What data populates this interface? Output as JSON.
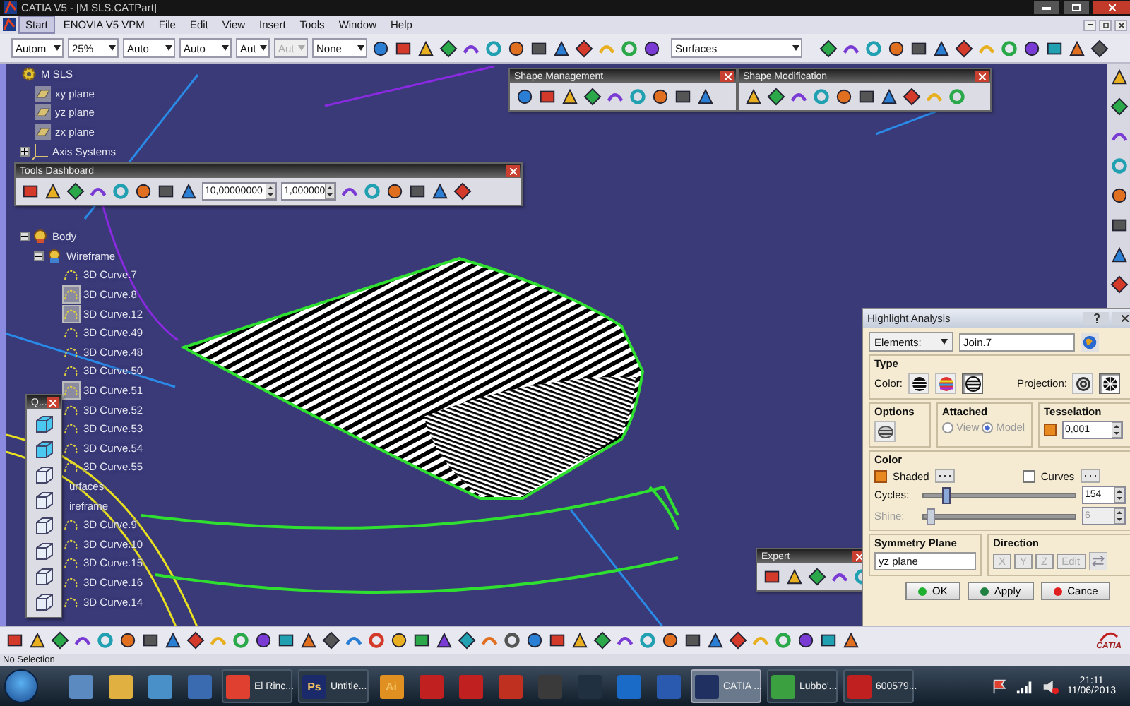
{
  "window": {
    "title": "CATIA V5 - [M SLS.CATPart]"
  },
  "menu": [
    {
      "label": "Start",
      "selected": true
    },
    {
      "label": "ENOVIA V5 VPM",
      "selected": false
    },
    {
      "label": "File",
      "selected": false
    },
    {
      "label": "Edit",
      "selected": false
    },
    {
      "label": "View",
      "selected": false
    },
    {
      "label": "Insert",
      "selected": false
    },
    {
      "label": "Tools",
      "selected": false
    },
    {
      "label": "Window",
      "selected": false
    },
    {
      "label": "Help",
      "selected": false
    }
  ],
  "toolbar": {
    "combos": [
      {
        "value": "Autom",
        "disabled": false
      },
      {
        "value": "25%",
        "disabled": false
      },
      {
        "value": "Auto",
        "disabled": false
      },
      {
        "value": "Auto",
        "disabled": false
      },
      {
        "value": "Aut",
        "disabled": false
      },
      {
        "value": "Aut",
        "disabled": true
      },
      {
        "value": "None",
        "disabled": false
      }
    ],
    "workbench": "Surfaces"
  },
  "tree": {
    "label": "M SLS",
    "kind": "part",
    "children": [
      {
        "label": "xy plane",
        "kind": "plane"
      },
      {
        "label": "yz plane",
        "kind": "plane"
      },
      {
        "label": "zx plane",
        "kind": "plane"
      },
      {
        "label": "Axis Systems",
        "kind": "axis",
        "expanded": false
      },
      {
        "label": "Body",
        "kind": "body",
        "expanded": true,
        "children": [
          {
            "label": "Wireframe",
            "kind": "set",
            "expanded": true,
            "children": [
              {
                "label": "3D Curve.7",
                "kind": "curve",
                "hidden": false
              },
              {
                "label": "3D Curve.8",
                "kind": "curve",
                "hidden": true
              },
              {
                "label": "3D Curve.12",
                "kind": "curve",
                "hidden": true
              },
              {
                "label": "3D Curve.49",
                "kind": "curve",
                "hidden": false
              },
              {
                "label": "3D Curve.48",
                "kind": "curve",
                "hidden": false
              },
              {
                "label": "3D Curve.50",
                "kind": "curve",
                "hidden": false
              },
              {
                "label": "3D Curve.51",
                "kind": "curve",
                "hidden": true
              },
              {
                "label": "3D Curve.52",
                "kind": "curve",
                "hidden": false
              },
              {
                "label": "3D Curve.53",
                "kind": "curve",
                "hidden": false
              },
              {
                "label": "3D Curve.54",
                "kind": "curve",
                "hidden": false
              },
              {
                "label": "3D Curve.55",
                "kind": "curve",
                "hidden": false
              }
            ]
          },
          {
            "label": "urfaces",
            "kind": "cut"
          },
          {
            "label": "ireframe",
            "kind": "cut",
            "children": [
              {
                "label": "3D Curve.9",
                "kind": "curve",
                "hidden": false
              },
              {
                "label": "3D Curve.10",
                "kind": "curve",
                "hidden": false
              },
              {
                "label": "3D Curve.15",
                "kind": "curve",
                "hidden": false
              },
              {
                "label": "3D Curve.16",
                "kind": "curve",
                "hidden": false
              },
              {
                "label": "3D Curve.14",
                "kind": "curve",
                "hidden": false
              }
            ]
          }
        ]
      }
    ]
  },
  "tools_dashboard": {
    "title": "Tools Dashboard",
    "fields": [
      "10,00000000",
      "1,000000"
    ]
  },
  "shape_management": {
    "title": "Shape Management"
  },
  "shape_modification": {
    "title": "Shape Modification"
  },
  "quick_view": {
    "title": "Q..."
  },
  "expert": {
    "title": "Expert"
  },
  "highlight_analysis": {
    "title": "Highlight Analysis",
    "elements": {
      "label": "Elements:",
      "value": "Join.7"
    },
    "type": {
      "title": "Type",
      "color_label": "Color:",
      "color_modes": [
        {
          "selected": false
        },
        {
          "selected": false
        },
        {
          "selected": true
        }
      ],
      "projection_label": "Projection:",
      "projections": [
        {
          "selected": false
        },
        {
          "selected": true
        }
      ]
    },
    "options": {
      "title": "Options"
    },
    "attached": {
      "title": "Attached",
      "choices": [
        {
          "label": "View",
          "selected": false,
          "disabled": true
        },
        {
          "label": "Model",
          "selected": true,
          "disabled": true
        }
      ]
    },
    "tesselation": {
      "title": "Tesselation",
      "checked": true,
      "value": "0,001"
    },
    "color": {
      "title": "Color",
      "toggles": [
        {
          "label": "Shaded",
          "checked": true
        },
        {
          "label": "Curves",
          "checked": false
        }
      ],
      "sliders": [
        {
          "label": "Cycles:",
          "level": 0.14,
          "value": "154",
          "disabled": false
        },
        {
          "label": "Shine:",
          "level": 0.04,
          "value": "6",
          "disabled": true
        }
      ]
    },
    "symmetry": {
      "title": "Symmetry Plane",
      "value": "yz plane"
    },
    "direction": {
      "title": "Direction",
      "buttons": [
        {
          "label": "X",
          "disabled": true
        },
        {
          "label": "Y",
          "disabled": true
        },
        {
          "label": "Z",
          "disabled": true
        },
        {
          "label": "Edit",
          "disabled": true
        }
      ]
    },
    "buttons": [
      {
        "label": "OK",
        "kind": "ok"
      },
      {
        "label": "Apply",
        "kind": "apply"
      },
      {
        "label": "Cance",
        "kind": "cancel"
      }
    ]
  },
  "brand": "CATIA",
  "status_bar": {
    "text": "No Selection"
  },
  "taskbar": {
    "items": [
      {
        "kind": "pinned"
      },
      {
        "kind": "pinned"
      },
      {
        "kind": "pinned"
      },
      {
        "kind": "pinned"
      },
      {
        "kind": "window",
        "label": "El Rinc...",
        "selected": false
      },
      {
        "kind": "window",
        "label": "Untitle...",
        "badge": "Ps",
        "selected": false
      },
      {
        "kind": "pinned",
        "badge": "Ai"
      },
      {
        "kind": "pinned"
      },
      {
        "kind": "pinned"
      },
      {
        "kind": "pinned"
      },
      {
        "kind": "pinned"
      },
      {
        "kind": "pinned"
      },
      {
        "kind": "pinned"
      },
      {
        "kind": "pinned"
      },
      {
        "kind": "window",
        "label": "CATIA ...",
        "selected": true
      },
      {
        "kind": "window",
        "label": "Lubbo'...",
        "selected": false
      },
      {
        "kind": "window",
        "label": "600579...",
        "selected": false
      }
    ],
    "time": "21:11",
    "date": "11/06/2013"
  }
}
